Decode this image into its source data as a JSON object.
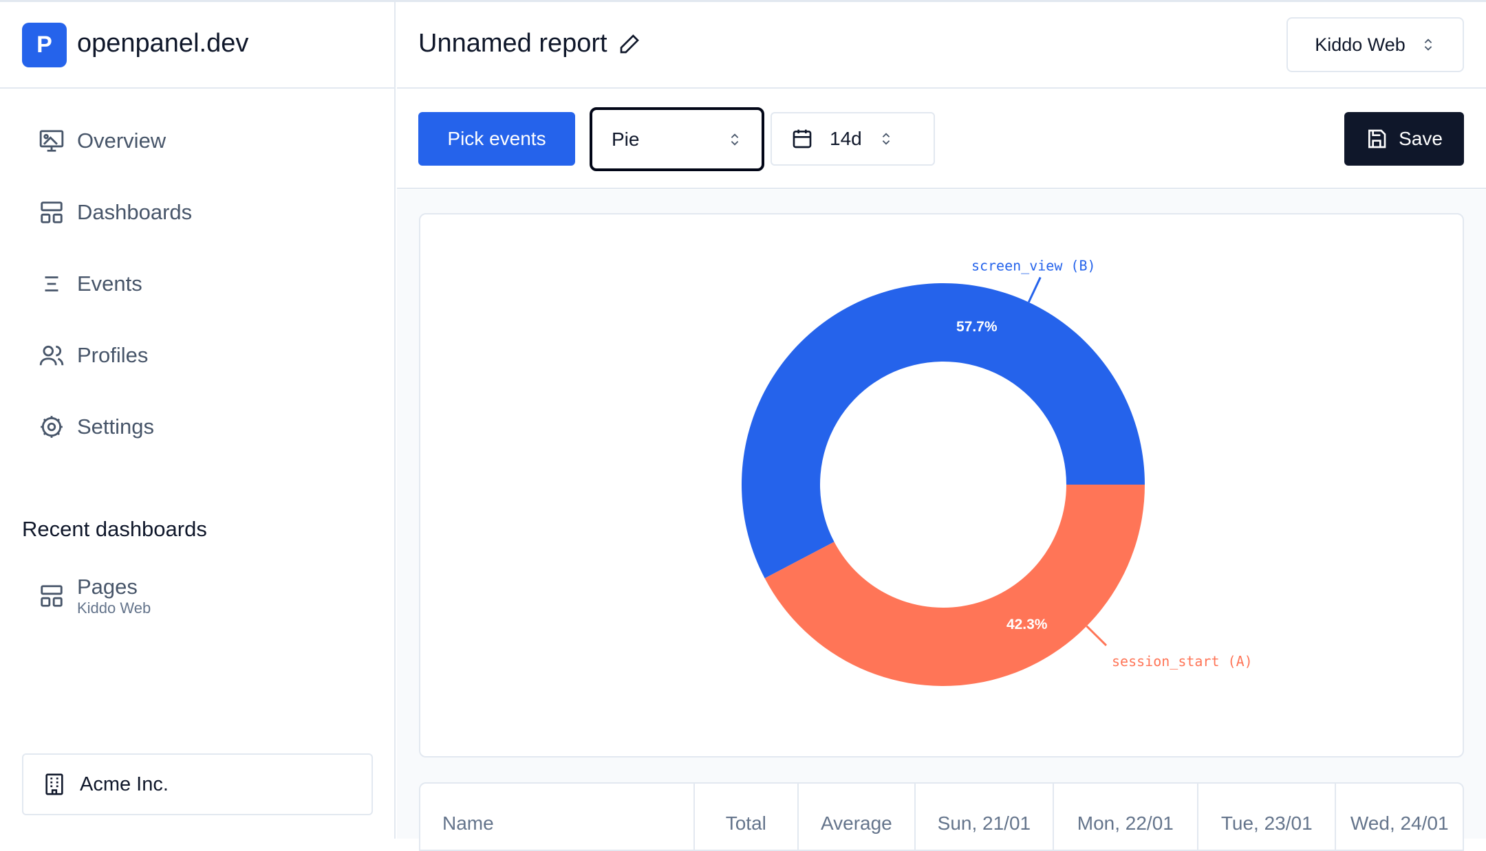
{
  "sidebar": {
    "brand": "openpanel.dev",
    "logo": "P",
    "nav": [
      {
        "label": "Overview",
        "icon": "presentation-icon"
      },
      {
        "label": "Dashboards",
        "icon": "layout-icon"
      },
      {
        "label": "Events",
        "icon": "list-icon"
      },
      {
        "label": "Profiles",
        "icon": "users-icon"
      },
      {
        "label": "Settings",
        "icon": "gear-icon"
      }
    ],
    "recent_heading": "Recent dashboards",
    "recent": [
      {
        "title": "Pages",
        "subtitle": "Kiddo Web"
      }
    ],
    "org": "Acme Inc."
  },
  "header": {
    "title": "Unnamed report",
    "project": "Kiddo Web"
  },
  "toolbar": {
    "pick": "Pick events",
    "chart_type": "Pie",
    "range": "14d",
    "save": "Save"
  },
  "colors": {
    "blue": "#2563eb",
    "orange": "#ff7557"
  },
  "chart_data": {
    "type": "pie",
    "donut": true,
    "slices": [
      {
        "name": "screen_view (B)",
        "value": 57.7,
        "label": "57.7%",
        "color": "#2563eb"
      },
      {
        "name": "session_start (A)",
        "value": 42.3,
        "label": "42.3%",
        "color": "#ff7557"
      }
    ]
  },
  "table": {
    "headers": [
      "Name",
      "Total",
      "Average",
      "Sun, 21/01",
      "Mon, 22/01",
      "Tue, 23/01",
      "Wed, 24/01"
    ]
  }
}
